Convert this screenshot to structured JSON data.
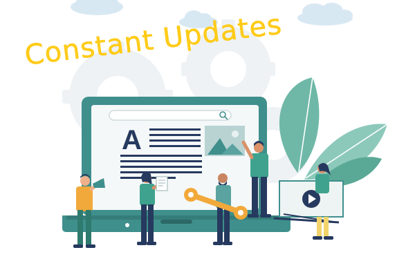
{
  "headline": {
    "text": "Constant Updates"
  },
  "colors": {
    "accent_yellow": "#ffcc1a",
    "laptop_teal": "#3f8f8c",
    "cloud_blue": "#d8e8f3",
    "gear_grey": "#eef2f5",
    "leaf_teal": "#6fb8a7",
    "dark_navy": "#26395e"
  },
  "illustration": {
    "laptop_screen": {
      "search_bar": true,
      "article_letter": "A",
      "image_placeholder": "mountain-image-icon"
    },
    "people": [
      {
        "role": "person-with-megaphone"
      },
      {
        "role": "person-with-document"
      },
      {
        "role": "person-with-wrench"
      },
      {
        "role": "person-pointing-at-screen"
      },
      {
        "role": "person-with-video-panel"
      }
    ]
  }
}
